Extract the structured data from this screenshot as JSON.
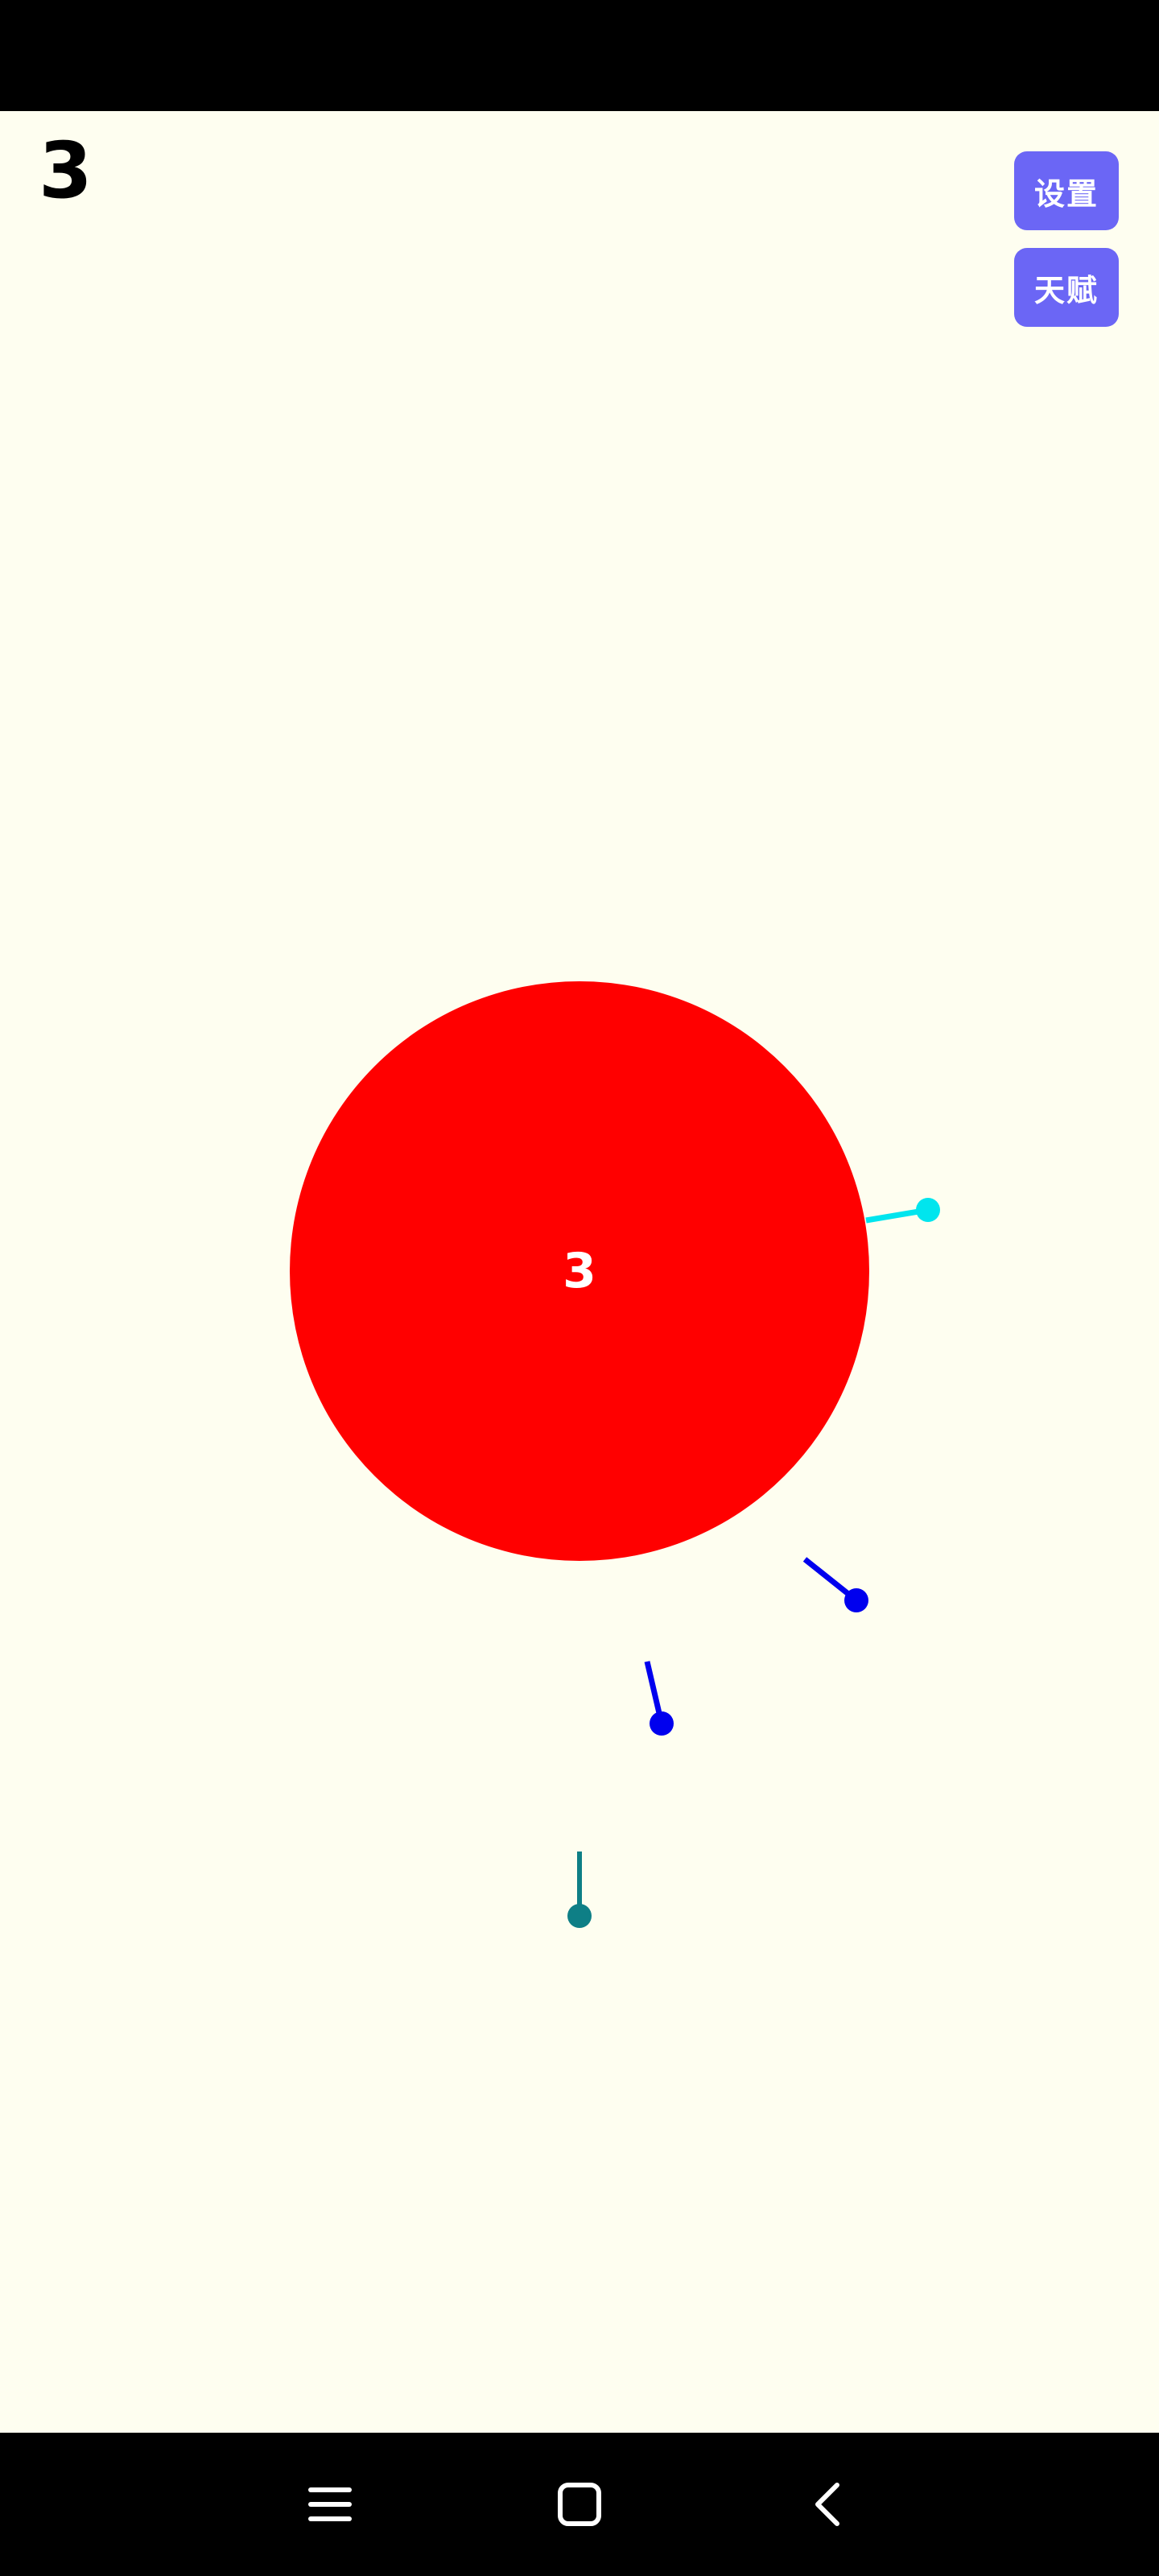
{
  "score": "3",
  "buttons": {
    "settings": "设置",
    "talent": "天赋"
  },
  "target": {
    "label": "3",
    "color": "#FF0000"
  },
  "pins": [
    {
      "color": "#00E5EE"
    },
    {
      "color": "#0000EE"
    },
    {
      "color": "#0000EE"
    }
  ],
  "launcher": {
    "color": "#0E7F86"
  },
  "colors": {
    "background": "#FEFEF0",
    "button": "#6B66F5"
  },
  "nav": {
    "icons": [
      "menu-icon",
      "home-icon",
      "back-icon"
    ]
  }
}
